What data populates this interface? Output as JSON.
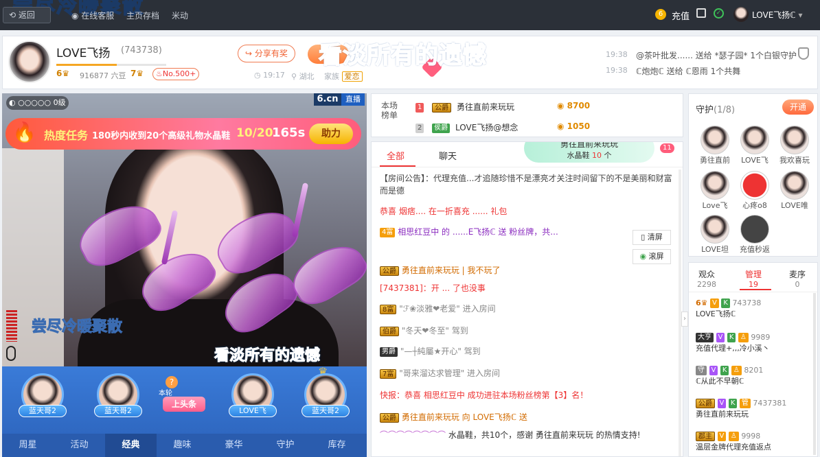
{
  "topbar": {
    "overlay_text": "尝尽冷暖聚散",
    "back_label": "返回",
    "nav_items": [
      "在线客服",
      "主页存档",
      "米动"
    ],
    "recharge_label": "充值",
    "username": "LOVE飞扬ℂ"
  },
  "anchor": {
    "name": "LOVE飞扬",
    "id": "(743738)",
    "level": "6",
    "beans": "916877 六豆",
    "rich_level": "7",
    "rank_badge": "No.500+",
    "share_label": "分享有奖",
    "time": "19:17",
    "location": "湖北",
    "family_label": "家族",
    "family_tag": "爱恋",
    "slogan_overlay": "看淡所有的遗憾"
  },
  "ticker": [
    {
      "time": "19:38",
      "text": "@茶叶批发...... 送给 *瑟子园* 1个白银守护"
    },
    {
      "time": "19:38",
      "text": "ℂ炮炮ℂ 送给 ℂ恩雨 1个共舞"
    }
  ],
  "video": {
    "level_label": "0级",
    "brand": "6.cn",
    "live_badge": "直播",
    "task_title": "热度任务",
    "task_desc": "180秒内收到20个高级礼物水晶鞋",
    "task_progress": "10/20",
    "task_time": "165s",
    "help_label": "助力",
    "subtitle_1": "尝尽冷暖聚散",
    "subtitle_2": "看淡所有的遗憾"
  },
  "seats": [
    {
      "name": "蓝天哥2"
    },
    {
      "name": "蓝天哥2"
    },
    {
      "name": "上头条",
      "tag": "本轮"
    },
    {
      "name": "LOVE飞"
    },
    {
      "name": "蓝天哥2"
    }
  ],
  "bottom_tabs": [
    "周星",
    "活动",
    "经典",
    "趣味",
    "豪华",
    "守护",
    "库存"
  ],
  "rank": {
    "label": "本场榜单",
    "rows": [
      {
        "pos": "1",
        "badge": "公爵",
        "name": "勇往直前来玩玩",
        "score": "8700"
      },
      {
        "pos": "2",
        "badge": "侯爵",
        "name": "LOVE飞扬@想念",
        "score": "1050"
      }
    ]
  },
  "chat": {
    "tabs": [
      "全部",
      "聊天"
    ],
    "gift_popup": {
      "user": "勇往直前来玩玩",
      "gift": "水晶鞋",
      "count": "10",
      "unit": "个",
      "badge": "11"
    },
    "clear_label": "清屏",
    "scroll_label": "滚屏",
    "lines": [
      {
        "text": "【房间公告】：代理充值...才追随珍惜不是漂亮才关注时间留下的不是美丽和财富而是德"
      },
      {
        "text": "恭喜 烟痞.... 在一折喜充 ...... 礼包"
      },
      {
        "badge": "4富",
        "text": "相思红豆中 的 ......E飞扬ℂ 送 粉丝牌，共..."
      },
      {
        "badge": "公爵",
        "text": "勇往直前来玩玩 | 我不玩了"
      },
      {
        "text": "[7437381]：开 ... 了也没事"
      },
      {
        "badge": "8富",
        "text": "\"ℱ❀淡雅❤老爱\" 进入房间"
      },
      {
        "badge": "伯爵",
        "text": "\"冬天❤冬至\" 驾到"
      },
      {
        "badge": "男爵",
        "text": "\"—┼純屬★开心\" 驾到"
      },
      {
        "badge": "7富",
        "text": "\"哥来溜达求管理\" 进入房间"
      },
      {
        "text": "快报：恭喜 相思红豆中 成功进驻本场粉丝榜第【3】名！"
      },
      {
        "badge": "公爵",
        "text": "勇往直前来玩玩 向 LOVE飞扬ℂ 送"
      },
      {
        "text": "水晶鞋，共10个，感谢 勇往直前来玩玩 的热情支持!"
      }
    ]
  },
  "guard": {
    "title": "守护",
    "count": "(1/8)",
    "open_label": "开通",
    "members": [
      "勇往直前",
      "LOVE飞",
      "我欢喜玩",
      "Love飞",
      "心疼o8",
      "LOVE唯",
      "LOVE坦",
      "充值秒返"
    ]
  },
  "audience": {
    "tabs": [
      {
        "label": "观众",
        "count": "2298"
      },
      {
        "label": "管理",
        "count": "19"
      },
      {
        "label": "麦序",
        "count": "0"
      }
    ],
    "rows": [
      {
        "badge": "6",
        "id": "743738",
        "name": "LOVE飞扬ℂ"
      },
      {
        "badge": "大亨",
        "id": "9989",
        "name": "充值代理+,,,冷小溪丶"
      },
      {
        "badge": "守",
        "id": "8201",
        "name": "ℂ从此不早朝ℂ"
      },
      {
        "badge": "公爵",
        "id": "7437381",
        "name": "勇往直前来玩玩"
      },
      {
        "badge": "郡主",
        "id": "9998",
        "name": "温层金牌代理充值返点"
      }
    ]
  },
  "colors": {
    "accent": "#ff6a2e",
    "chat_tab_active": "#e33",
    "rank_gold": "#e08a00"
  }
}
